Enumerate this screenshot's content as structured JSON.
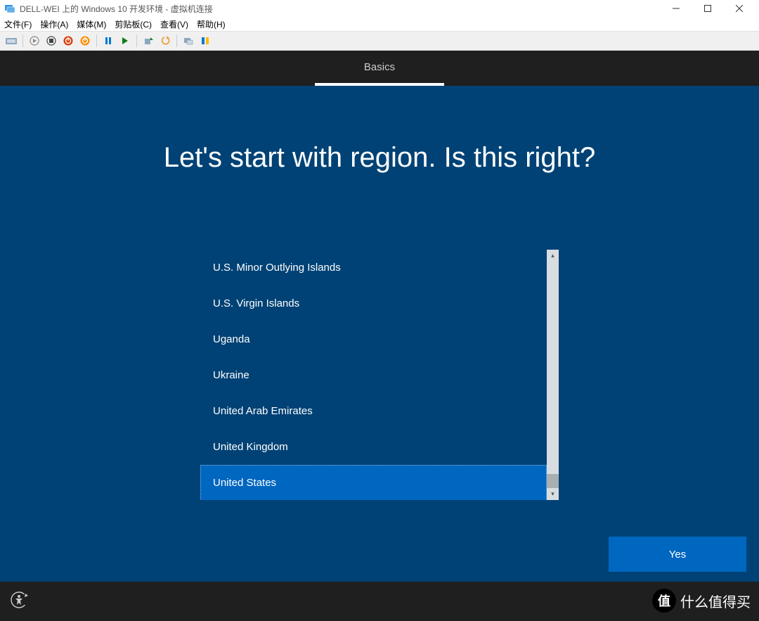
{
  "host": {
    "title": "DELL-WEI 上的 Windows 10 开发环境 - 虚拟机连接",
    "menu": [
      "文件(F)",
      "操作(A)",
      "媒体(M)",
      "剪贴板(C)",
      "查看(V)",
      "帮助(H)"
    ]
  },
  "oobe": {
    "tab": "Basics",
    "heading": "Let's start with region. Is this right?",
    "regions": [
      "U.S. Minor Outlying Islands",
      "U.S. Virgin Islands",
      "Uganda",
      "Ukraine",
      "United Arab Emirates",
      "United Kingdom",
      "United States"
    ],
    "selected_index": 6,
    "yes_label": "Yes"
  },
  "watermark": {
    "glyph": "值",
    "text": "什么值得买"
  }
}
